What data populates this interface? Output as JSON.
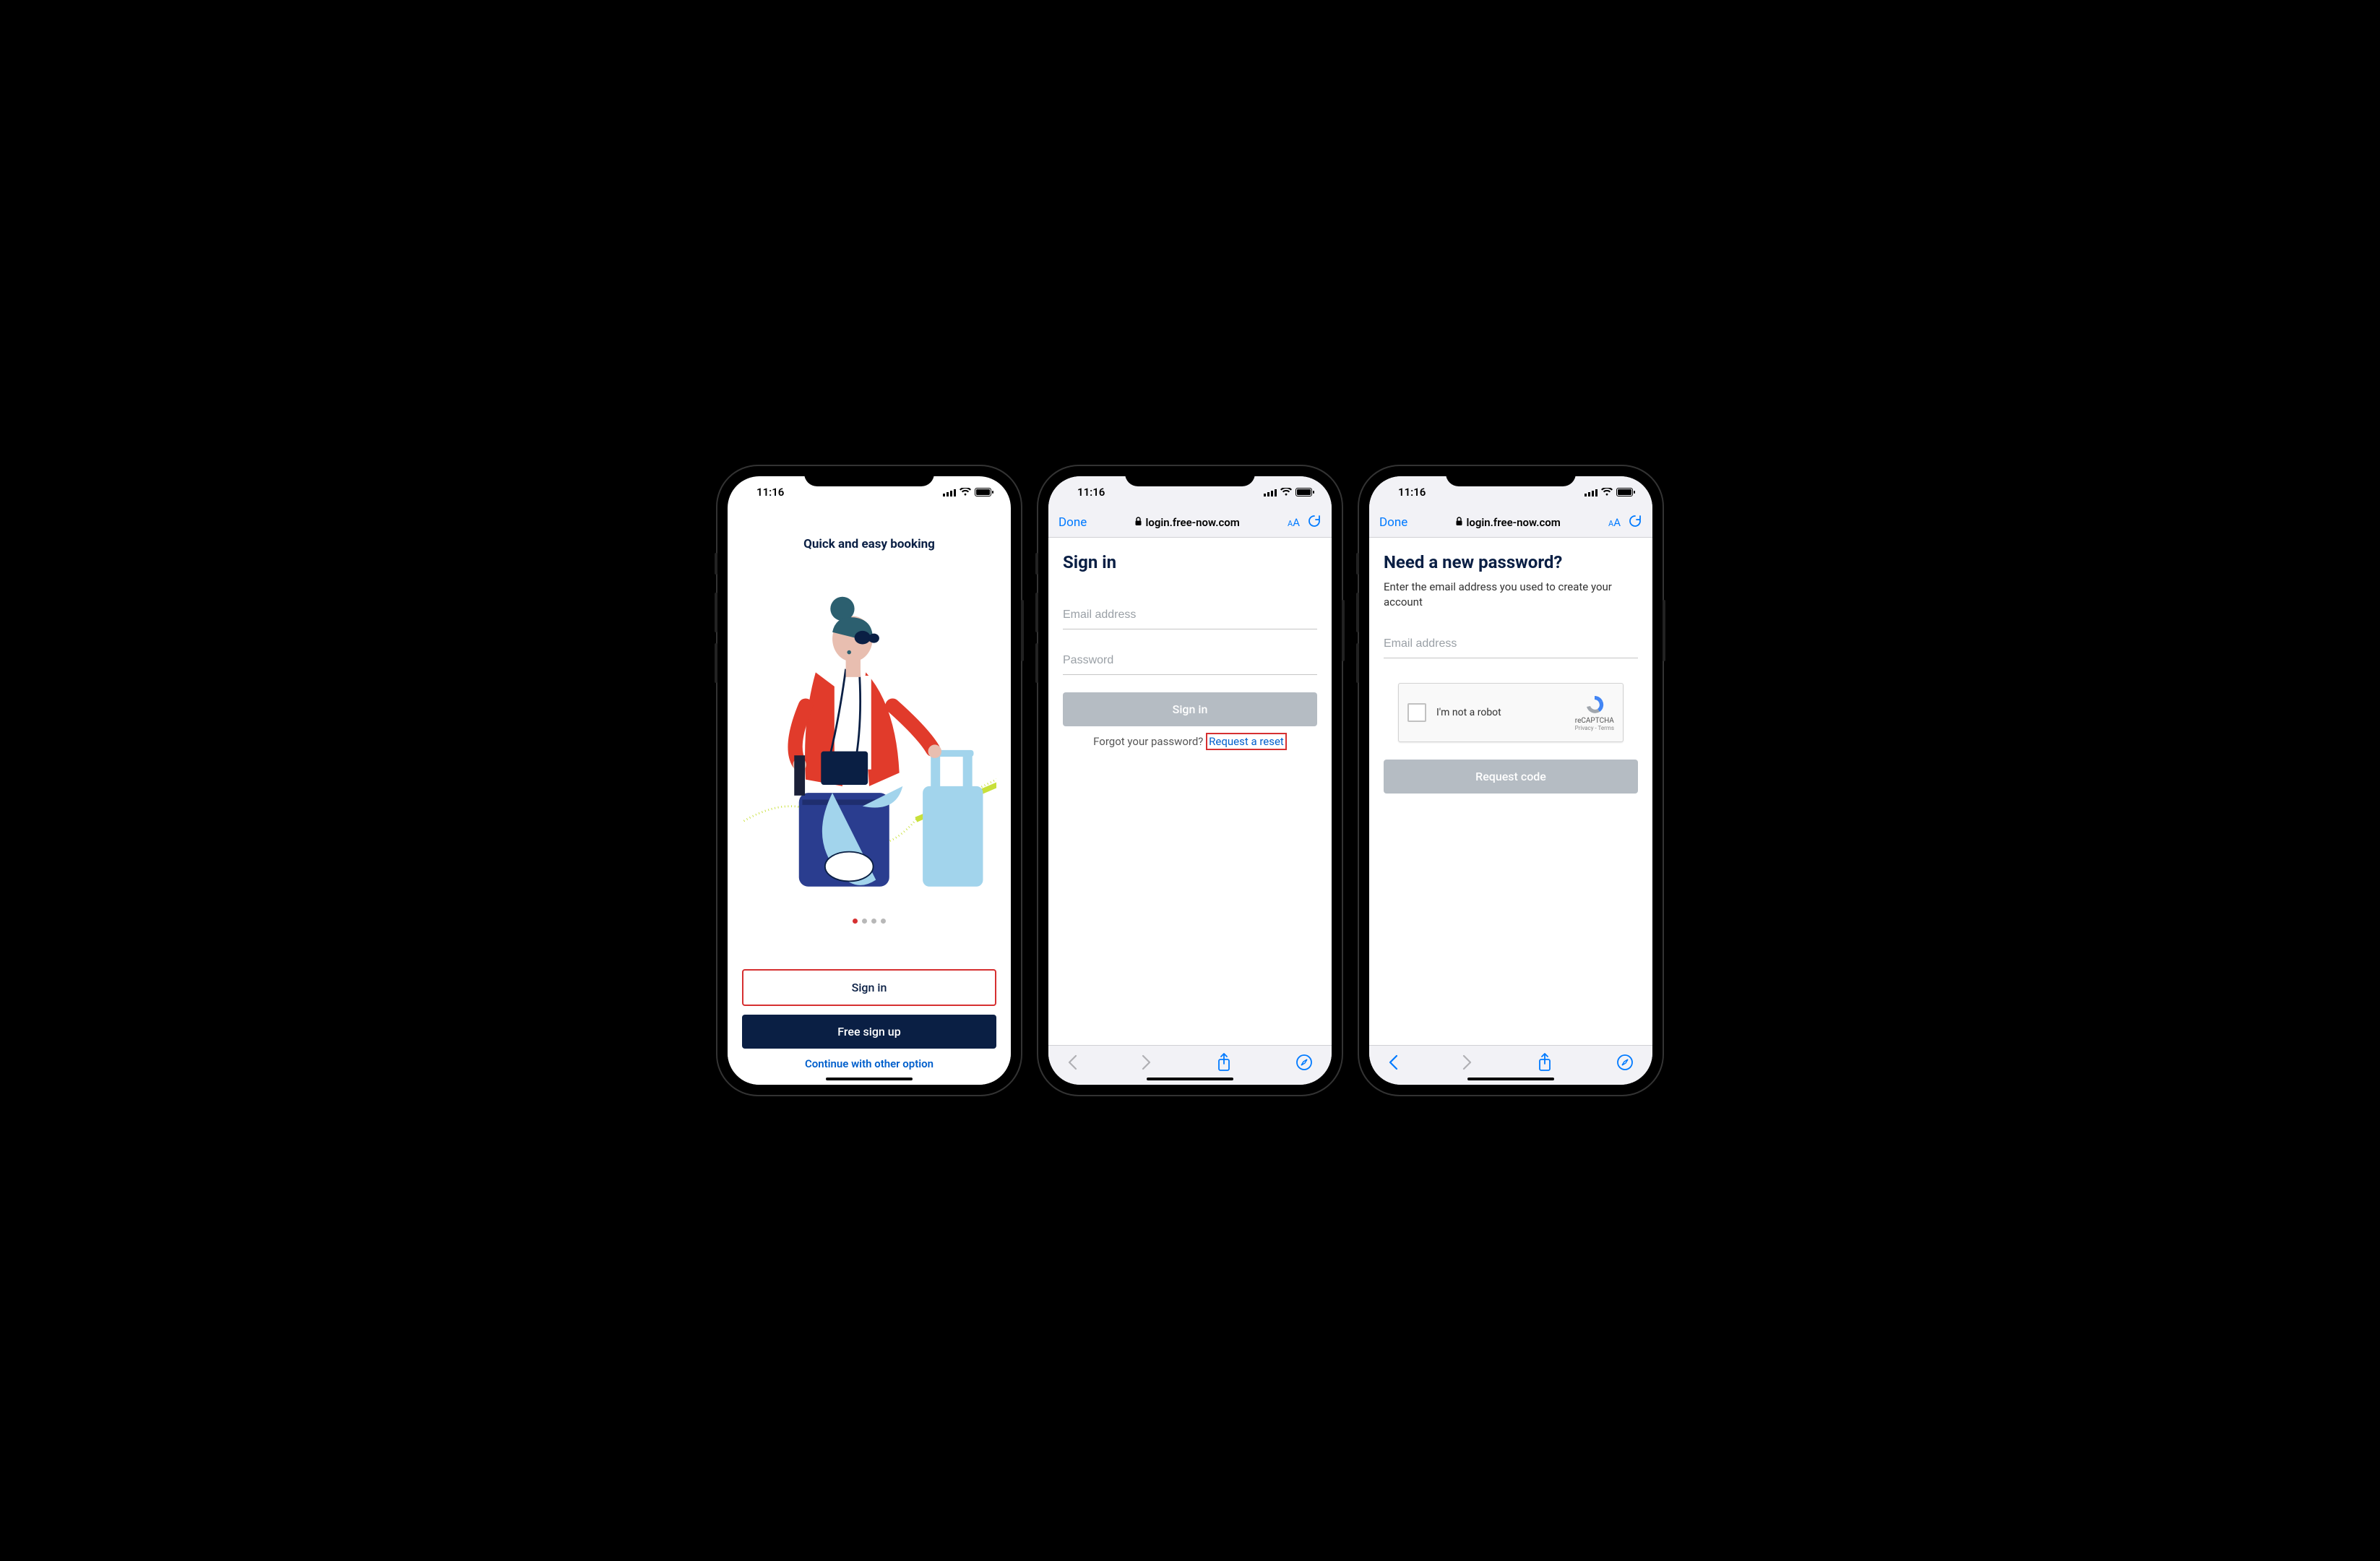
{
  "status": {
    "time": "11:16"
  },
  "browser": {
    "done": "Done",
    "url": "login.free-now.com",
    "aa_small": "A",
    "aa_large": "A"
  },
  "screen1": {
    "title": "Quick and easy booking",
    "signin": "Sign in",
    "signup": "Free sign up",
    "other": "Continue with other option"
  },
  "screen2": {
    "heading": "Sign in",
    "email_ph": "Email address",
    "password_ph": "Password",
    "signin_btn": "Sign in",
    "forgot": "Forgot your password?",
    "reset": "Request a reset"
  },
  "screen3": {
    "heading": "Need a new password?",
    "sub": "Enter the email address you used to create your account",
    "email_ph": "Email address",
    "recaptcha": "I'm not a robot",
    "recaptcha_brand": "reCAPTCHA",
    "recaptcha_terms": "Privacy - Terms",
    "request_btn": "Request code"
  }
}
